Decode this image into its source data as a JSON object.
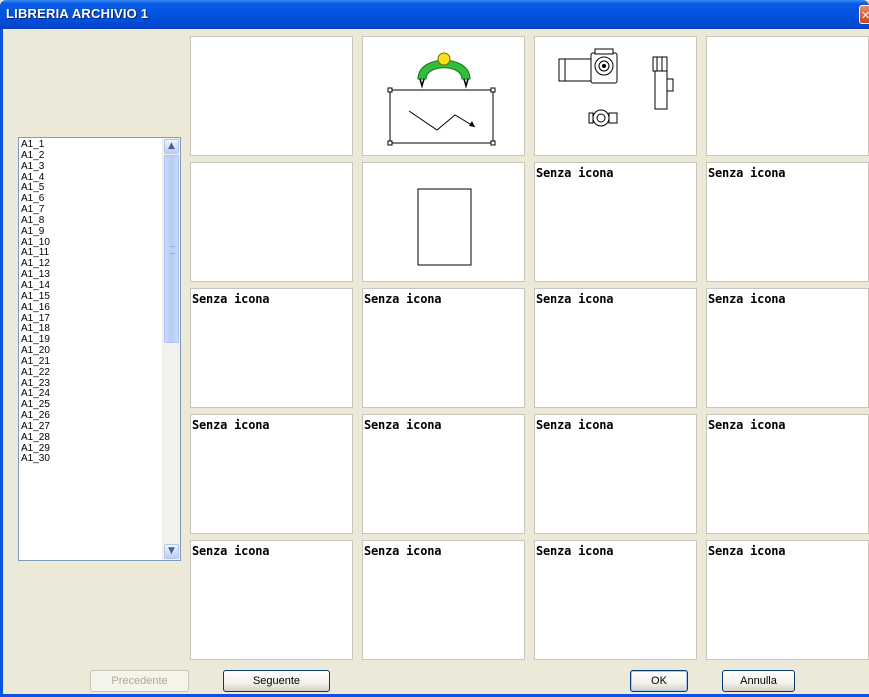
{
  "window": {
    "title": "LIBRERIA ARCHIVIO 1",
    "close_glyph": "✕"
  },
  "list": {
    "items": [
      "A1_1",
      "A1_2",
      "A1_3",
      "A1_4",
      "A1_5",
      "A1_6",
      "A1_7",
      "A1_8",
      "A1_9",
      "A1_10",
      "A1_11",
      "A1_12",
      "A1_13",
      "A1_14",
      "A1_15",
      "A1_16",
      "A1_17",
      "A1_18",
      "A1_19",
      "A1_20",
      "A1_21",
      "A1_22",
      "A1_23",
      "A1_24",
      "A1_25",
      "A1_26",
      "A1_27",
      "A1_28",
      "A1_29",
      "A1_30"
    ],
    "scroll_up_glyph": "▲",
    "scroll_down_glyph": "▼"
  },
  "grid": {
    "cells": [
      {
        "label": "",
        "icon": "blank"
      },
      {
        "label": "",
        "icon": "crane-hook-icon"
      },
      {
        "label": "",
        "icon": "motor-assembly-icon"
      },
      {
        "label": "",
        "icon": "blank"
      },
      {
        "label": "",
        "icon": "blank"
      },
      {
        "label": "",
        "icon": "rectangle-icon"
      },
      {
        "label": "Senza icona",
        "icon": "none"
      },
      {
        "label": "Senza icona",
        "icon": "none"
      },
      {
        "label": "Senza icona",
        "icon": "none"
      },
      {
        "label": "Senza icona",
        "icon": "none"
      },
      {
        "label": "Senza icona",
        "icon": "none"
      },
      {
        "label": "Senza icona",
        "icon": "none"
      },
      {
        "label": "Senza icona",
        "icon": "none"
      },
      {
        "label": "Senza icona",
        "icon": "none"
      },
      {
        "label": "Senza icona",
        "icon": "none"
      },
      {
        "label": "Senza icona",
        "icon": "none"
      },
      {
        "label": "Senza icona",
        "icon": "none"
      },
      {
        "label": "Senza icona",
        "icon": "none"
      },
      {
        "label": "Senza icona",
        "icon": "none"
      },
      {
        "label": "Senza icona",
        "icon": "none"
      }
    ]
  },
  "buttons": {
    "previous": "Precedente",
    "next": "Seguente",
    "ok": "OK",
    "cancel": "Annulla"
  },
  "colors": {
    "titlebar": "#0053e0",
    "dialog_bg": "#ece9d8",
    "hook_green": "#2fbf3a",
    "hook_yellow": "#f4e21a"
  }
}
